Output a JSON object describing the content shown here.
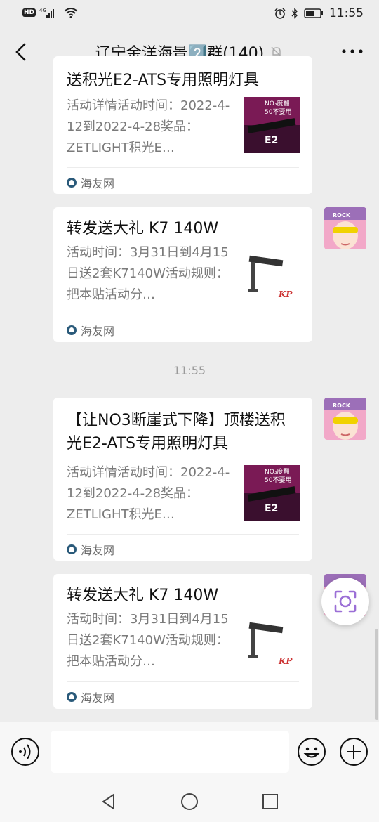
{
  "status": {
    "time": "11:55",
    "network": "4G",
    "hd": "HD"
  },
  "header": {
    "title": "辽宁金洋海景2️⃣群(140)"
  },
  "messages": [
    {
      "title": "送积光E2-ATS专用照明灯具",
      "desc": "活动详情活动时间：2022-4-12到2022-4-28奖品：ZETLIGHT积光E…",
      "source": "海友网"
    },
    {
      "title": "转发送大礼 K7 140W",
      "desc": "活动时间：3月31日到4月15日送2套K7140W活动规则：把本贴活动分…",
      "source": "海友网"
    },
    {
      "title": "【让NO3断崖式下降】顶楼送积光E2-ATS专用照明灯具",
      "desc": "活动详情活动时间：2022-4-12到2022-4-28奖品：ZETLIGHT积光E…",
      "source": "海友网"
    },
    {
      "title": "转发送大礼 K7 140W",
      "desc": "活动时间：3月31日到4月15日送2套K7140W活动规则：把本贴活动分…",
      "source": "海友网"
    }
  ],
  "timestamp": "11:55",
  "thumb_e2": {
    "line1": "NO₃度翻",
    "line2": "50不要用",
    "brand": "E2"
  },
  "thumb_k7": {
    "brand": "KP"
  },
  "avatar_text": "ROCK",
  "colors": {
    "background": "#ededed",
    "card": "#ffffff",
    "muted": "#7a7a7a",
    "scanner": "#9b6fd6"
  }
}
